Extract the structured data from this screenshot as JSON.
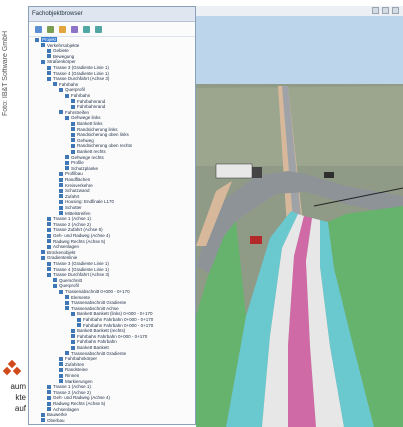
{
  "photo_credit": "Foto: IB&T Software GmbH",
  "logo_text": [
    "aum",
    "kte",
    "auf"
  ],
  "panel": {
    "title": "Fachobjektbrowser",
    "toolbar_icons": [
      "expand-icon",
      "filter-icon",
      "add-icon",
      "layer-icon",
      "up-icon",
      "down-icon"
    ]
  },
  "tree": [
    {
      "label": "Projekt",
      "level": 0,
      "selected": true
    },
    {
      "label": "Verkehrsobjekte",
      "level": 1
    },
    {
      "label": "Gebiete",
      "level": 2
    },
    {
      "label": "Bewegung",
      "level": 2
    },
    {
      "label": "Straßenkörper",
      "level": 1
    },
    {
      "label": "Trasse 3 (Gradiente Linie 1)",
      "level": 2
    },
    {
      "label": "Trasse 4 (Gradiente Linie 1)",
      "level": 2
    },
    {
      "label": "Trasse Durchfahrt (Achse 3)",
      "level": 2
    },
    {
      "label": "Fahrbahn",
      "level": 3
    },
    {
      "label": "Querprofil",
      "level": 4
    },
    {
      "label": "Fahrbahn",
      "level": 5
    },
    {
      "label": "Fahrbahnrand",
      "level": 6
    },
    {
      "label": "Fahrbahnrand",
      "level": 6
    },
    {
      "label": "Fahrstreifen",
      "level": 4
    },
    {
      "label": "Gehwege links",
      "level": 5
    },
    {
      "label": "Bankett links",
      "level": 6
    },
    {
      "label": "Randsicherung links",
      "level": 6
    },
    {
      "label": "Randsicherung oben links",
      "level": 6
    },
    {
      "label": "Gehweg",
      "level": 6
    },
    {
      "label": "Randsicherung oben rechts",
      "level": 6
    },
    {
      "label": "Bankett rechts",
      "level": 6
    },
    {
      "label": "Gehwege rechts",
      "level": 5
    },
    {
      "label": "Profile",
      "level": 5
    },
    {
      "label": "Schutzplanke",
      "level": 5
    },
    {
      "label": "Profilbau",
      "level": 4
    },
    {
      "label": "Randflächen",
      "level": 4
    },
    {
      "label": "Kreisverkehre",
      "level": 4
    },
    {
      "label": "Schutzwand",
      "level": 4
    },
    {
      "label": "Zufahrt",
      "level": 4
    },
    {
      "label": "Housing: Endfinale L170",
      "level": 4
    },
    {
      "label": "Schotter",
      "level": 4
    },
    {
      "label": "Mittelstreifen",
      "level": 4
    },
    {
      "label": "Trasse 1 (Achse 1)",
      "level": 2
    },
    {
      "label": "Trasse 2 (Achse 2)",
      "level": 2
    },
    {
      "label": "Trasse Zufahrt (Achse 6)",
      "level": 2
    },
    {
      "label": "Geh- und Radweg (Achse 4)",
      "level": 2
    },
    {
      "label": "Radweg Rechts (Achse 5)",
      "level": 2
    },
    {
      "label": "Achsenlagen",
      "level": 2
    },
    {
      "label": "Brückenobjekt",
      "level": 1
    },
    {
      "label": "Gradientenlinie",
      "level": 1
    },
    {
      "label": "Trasse 3 (Gradiente Linie 1)",
      "level": 2
    },
    {
      "label": "Trasse 4 (Gradiente Linie 1)",
      "level": 2
    },
    {
      "label": "Trasse Durchfahrt (Achse 3)",
      "level": 2
    },
    {
      "label": "Querschnitt",
      "level": 3
    },
    {
      "label": "Querprofil",
      "level": 3
    },
    {
      "label": "Trassenabschnitt 0+000 - 0+170",
      "level": 4
    },
    {
      "label": "Elemente",
      "level": 5
    },
    {
      "label": "Trassenabschnitt Gradiente",
      "level": 5
    },
    {
      "label": "Trassenabschnitt Achse",
      "level": 5
    },
    {
      "label": "Bankett Bankett (links) 0+000 - 0+170",
      "level": 6
    },
    {
      "label": "Fahrbahn Fahrbahn 0+000 - 0+170",
      "level": 7
    },
    {
      "label": "Fahrbahn Fahrbahn 0+000 - 0+170",
      "level": 7
    },
    {
      "label": "Bankett Bankett (rechts)",
      "level": 6
    },
    {
      "label": "Fahrbahn Fahrbahn 0+000 - 0+170",
      "level": 6
    },
    {
      "label": "Fahrbahn Fahrbahn",
      "level": 6
    },
    {
      "label": "Bankett Bankett",
      "level": 6
    },
    {
      "label": "Trassenabschnitt Gradiente",
      "level": 5
    },
    {
      "label": "Fahrbahnkörper",
      "level": 4
    },
    {
      "label": "Zufahrten",
      "level": 4
    },
    {
      "label": "Randsteine",
      "level": 4
    },
    {
      "label": "Rinnen",
      "level": 4
    },
    {
      "label": "Markierungen",
      "level": 4
    },
    {
      "label": "Trasse 1 (Achse 1)",
      "level": 2
    },
    {
      "label": "Trasse 2 (Achse 2)",
      "level": 2
    },
    {
      "label": "Geh- und Radweg (Achse 4)",
      "level": 2
    },
    {
      "label": "Radweg Rechts (Achse 5)",
      "level": 2
    },
    {
      "label": "Achsenlagen",
      "level": 2
    },
    {
      "label": "Bauwerke",
      "level": 1
    },
    {
      "label": "Oberbau",
      "level": 1
    },
    {
      "label": "Bauwerk - Objekt - Gebäude",
      "level": 2
    }
  ],
  "viewport": {
    "sky_color": "#bcd5ea",
    "ground_color": "#8f9b86",
    "lane_colors": [
      "#6ac8cf",
      "#cf6aa6",
      "#d8b89a",
      "#66b36d",
      "#e7e7e7"
    ]
  }
}
